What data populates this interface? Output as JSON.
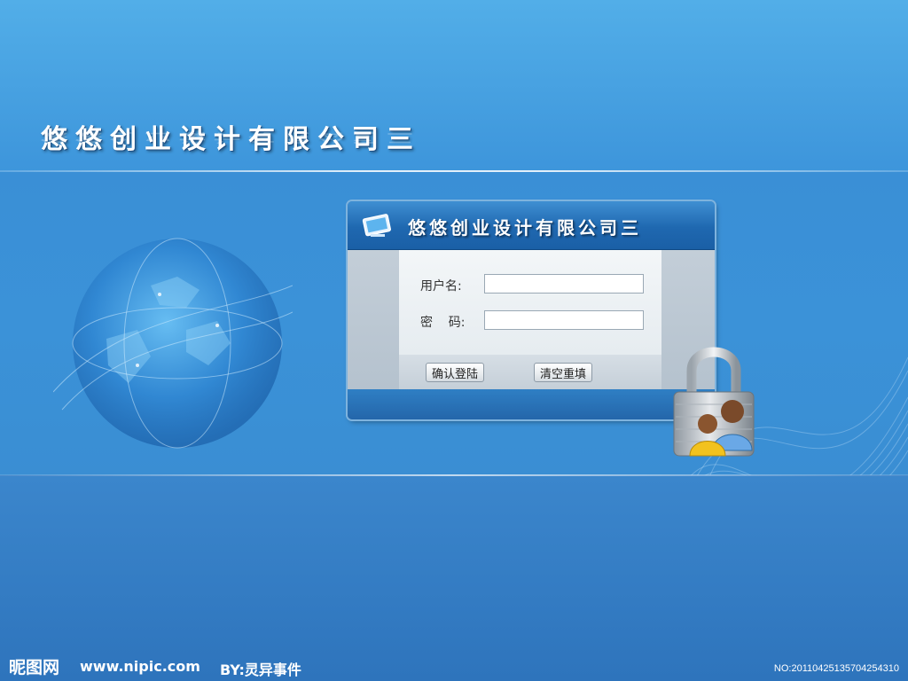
{
  "header": {
    "company_title": "悠悠创业设计有限公司三"
  },
  "login_panel": {
    "title": "悠悠创业设计有限公司三",
    "username_label": "用户名:",
    "password_label": "密    码:",
    "username_value": "",
    "password_value": "",
    "login_button": "确认登陆",
    "reset_button": "清空重填"
  },
  "watermark": {
    "site_name": "昵图网",
    "url": "www.nipic.com",
    "author": "BY:灵异事件",
    "image_number": "NO:20110425135704254310"
  },
  "icons": {
    "panel_icon": "monitor-icon",
    "lock_icon": "padlock-users-icon",
    "globe": "globe-graphic"
  },
  "colors": {
    "background_blue": "#3a8fd6",
    "panel_header": "#1f68b0",
    "form_background": "#eef2f5"
  }
}
